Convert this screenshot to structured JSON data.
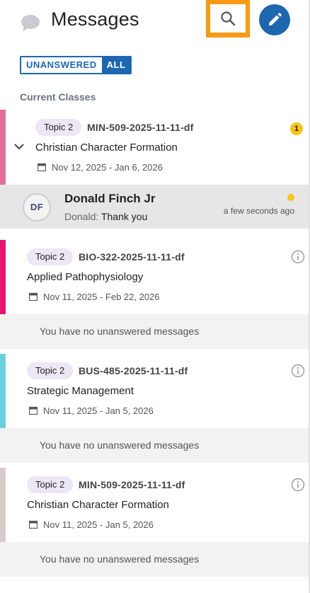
{
  "header": {
    "title": "Messages",
    "icons": {
      "chat": "chat-bubble-icon",
      "search": "search-icon",
      "compose": "pencil-icon"
    },
    "accent_color": "#1e67b0",
    "highlight_color": "#f79a16"
  },
  "filter": {
    "unanswered_label": "UNANSWERED",
    "all_label": "ALL",
    "selected": "ALL"
  },
  "section_label": "Current Classes",
  "classes": [
    {
      "topic": "Topic 2",
      "code": "MIN-509-2025-11-11-df",
      "name": "Christian Character Formation",
      "dates": "Nov 12, 2025 - Jan 6, 2026",
      "color": "#e26e9a",
      "badge": "1",
      "expanded": true,
      "message": {
        "initials": "DF",
        "sender": "Donald Finch Jr",
        "preview_from": "Donald:",
        "preview_text": " Thank you",
        "time": "a few seconds ago"
      }
    },
    {
      "topic": "Topic 2",
      "code": "BIO-322-2025-11-11-df",
      "name": "Applied Pathophysiology",
      "dates": "Nov 11, 2025 - Feb 22, 2026",
      "color": "#e5166f",
      "empty_text": "You have no unanswered messages"
    },
    {
      "topic": "Topic 2",
      "code": "BUS-485-2025-11-11-df",
      "name": "Strategic Management",
      "dates": "Nov 11, 2025 - Jan 5, 2026",
      "color": "#6ccfe0",
      "empty_text": "You have no unanswered messages"
    },
    {
      "topic": "Topic 2",
      "code": "MIN-509-2025-11-11-df",
      "name": "Christian Character Formation",
      "dates": "Nov 11, 2025 - Jan 5, 2026",
      "color": "#d9cbc9",
      "empty_text": "You have no unanswered messages"
    }
  ]
}
